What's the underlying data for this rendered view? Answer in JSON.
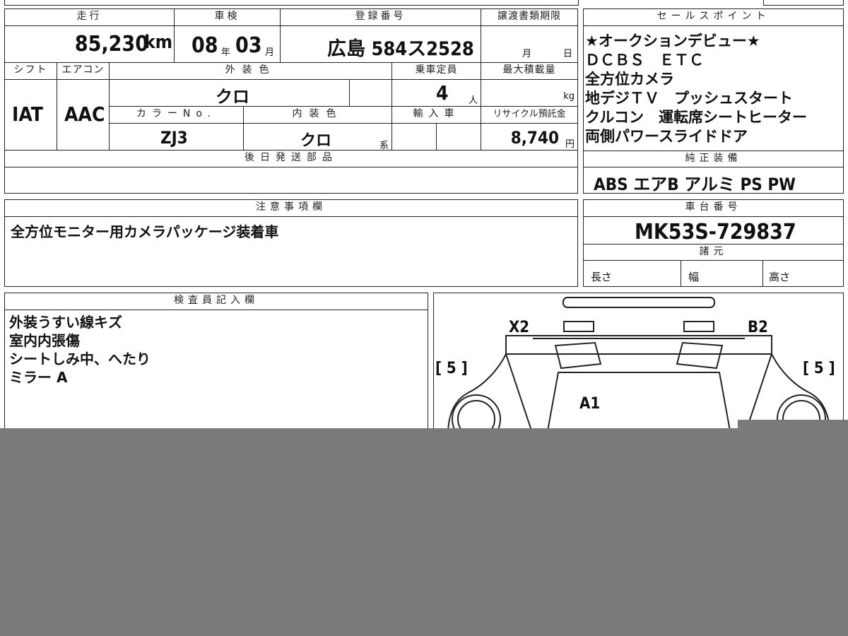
{
  "top_row": {
    "mileage_label": "走行",
    "mileage_value": "85,230",
    "mileage_unit": "km",
    "shaken_label": "車検",
    "shaken_year": "08",
    "shaken_year_unit": "年",
    "shaken_month": "03",
    "shaken_month_unit": "月",
    "reg_label": "登録番号",
    "reg_value": "広島 584ス2528",
    "transfer_label": "譲渡書類期限",
    "transfer_month_unit": "月",
    "transfer_day_unit": "日"
  },
  "second_block": {
    "shift_label": "シフト",
    "shift_value": "IAT",
    "aircon_label": "エアコン",
    "aircon_value": "AAC",
    "exterior_label": "外装色",
    "exterior_value": "クロ",
    "capacity_label": "乗車定員",
    "capacity_value": "4",
    "capacity_unit": "人",
    "maxload_label": "最大積載量",
    "maxload_unit": "kg",
    "colorno_label": "カラーNo.",
    "colorno_value": "ZJ3",
    "interior_label": "内装色",
    "interior_value": "クロ",
    "interior_unit": "系",
    "import_label": "輸入車",
    "recycle_label": "リサイクル預託金",
    "recycle_value": "8,740",
    "recycle_unit": "円",
    "later_parts_label": "後日発送部品"
  },
  "sales_points": {
    "title": "セールスポイント",
    "lines": [
      "★オークションデビュー★",
      "ＤＣＢＳ　ＥＴＣ",
      "全方位カメラ",
      "地デジＴＶ　プッシュスタート",
      "クルコン　運転席シートヒーター",
      "両側パワースライドドア"
    ]
  },
  "genuine_equipment": {
    "title": "純正装備",
    "value": "ABS エアB アルミ PS PW"
  },
  "notes": {
    "title": "注意事項欄",
    "text": "全方位モニター用カメラパッケージ装着車"
  },
  "chassis": {
    "title": "車台番号",
    "value": "MK53S-729837"
  },
  "specs": {
    "title": "諸元",
    "length_label": "長さ",
    "width_label": "幅",
    "height_label": "高さ"
  },
  "inspector": {
    "title": "検査員記入欄",
    "lines": [
      "外装うすい線キズ",
      "室内内張傷",
      "シートしみ中、へたり",
      "ミラー A"
    ]
  },
  "diagram": {
    "mark_x2": "X2",
    "mark_b2": "B2",
    "mark_a1": "A1",
    "left_bracket": "[ 5 ]",
    "right_bracket": "[ 5 ]"
  },
  "colors": {
    "overlay_gray": "#7a7a7a",
    "line": "#222222"
  }
}
